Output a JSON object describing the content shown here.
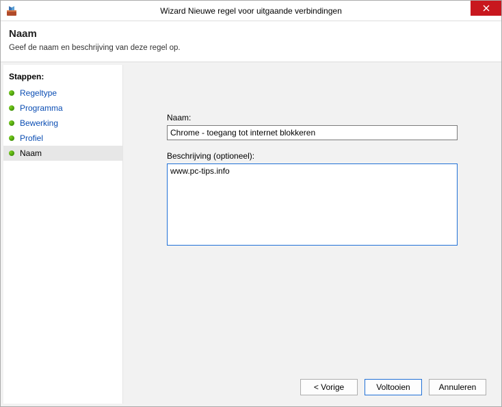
{
  "titlebar": {
    "title": "Wizard Nieuwe regel voor uitgaande verbindingen"
  },
  "header": {
    "title": "Naam",
    "subtitle": "Geef de naam en beschrijving van deze regel op."
  },
  "sidebar": {
    "heading": "Stappen:",
    "items": [
      {
        "label": "Regeltype",
        "current": false
      },
      {
        "label": "Programma",
        "current": false
      },
      {
        "label": "Bewerking",
        "current": false
      },
      {
        "label": "Profiel",
        "current": false
      },
      {
        "label": "Naam",
        "current": true
      }
    ]
  },
  "form": {
    "name_label": "Naam:",
    "name_value": "Chrome - toegang tot internet blokkeren",
    "desc_label": "Beschrijving (optioneel):",
    "desc_value": "www.pc-tips.info"
  },
  "buttons": {
    "back": "< Vorige",
    "finish": "Voltooien",
    "cancel": "Annuleren"
  }
}
